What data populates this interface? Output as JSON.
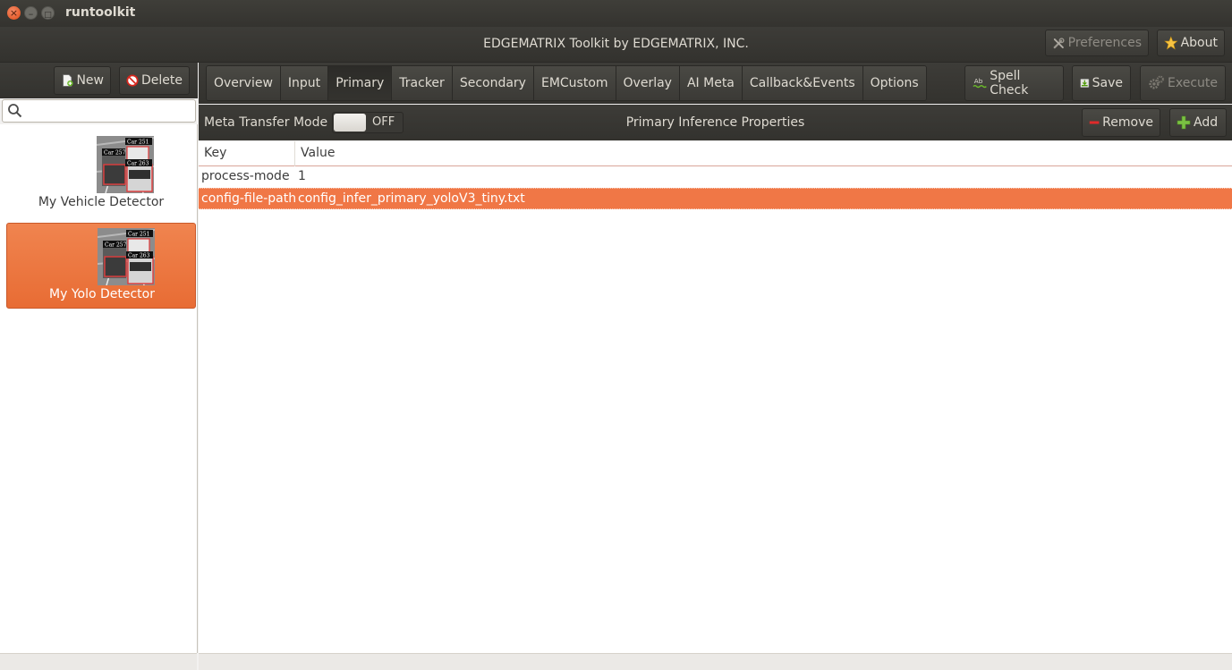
{
  "window": {
    "title": "runtoolkit",
    "controls": {
      "close": "×",
      "minimize": "–",
      "maximize": "□"
    }
  },
  "header": {
    "title": "EDGEMATRIX Toolkit by EDGEMATRIX, INC.",
    "preferences_label": "Preferences",
    "about_label": "About"
  },
  "sidebar": {
    "new_label": "New",
    "delete_label": "Delete",
    "search_placeholder": "",
    "items": [
      {
        "label": "My Vehicle Detector",
        "selected": false
      },
      {
        "label": "My Yolo Detector",
        "selected": true
      }
    ],
    "thumbnail_captions": [
      "Car 257",
      "Car 251",
      "Car 263"
    ]
  },
  "tabs": [
    {
      "label": "Overview"
    },
    {
      "label": "Input"
    },
    {
      "label": "Primary",
      "active": true
    },
    {
      "label": "Tracker"
    },
    {
      "label": "Secondary"
    },
    {
      "label": "EMCustom"
    },
    {
      "label": "Overlay"
    },
    {
      "label": "AI Meta"
    },
    {
      "label": "Callback&Events"
    },
    {
      "label": "Options"
    }
  ],
  "toolbar": {
    "spell_check_label": "Spell Check",
    "spell_check_icon_text": "Ab",
    "save_label": "Save",
    "execute_label": "Execute"
  },
  "properties": {
    "meta_transfer_label": "Meta Transfer Mode",
    "meta_transfer_state": "OFF",
    "title": "Primary Inference Properties",
    "remove_label": "Remove",
    "add_label": "Add"
  },
  "table": {
    "columns": [
      "Key",
      "Value"
    ],
    "rows": [
      {
        "key": "process-mode",
        "value": "1",
        "selected": false
      },
      {
        "key": "config-file-path",
        "value": "config_infer_primary_yoloV3_tiny.txt",
        "selected": true
      }
    ]
  },
  "colors": {
    "accent": "#f07746",
    "toolbar_dark": "#3c3b37",
    "close_button": "#e95420"
  }
}
